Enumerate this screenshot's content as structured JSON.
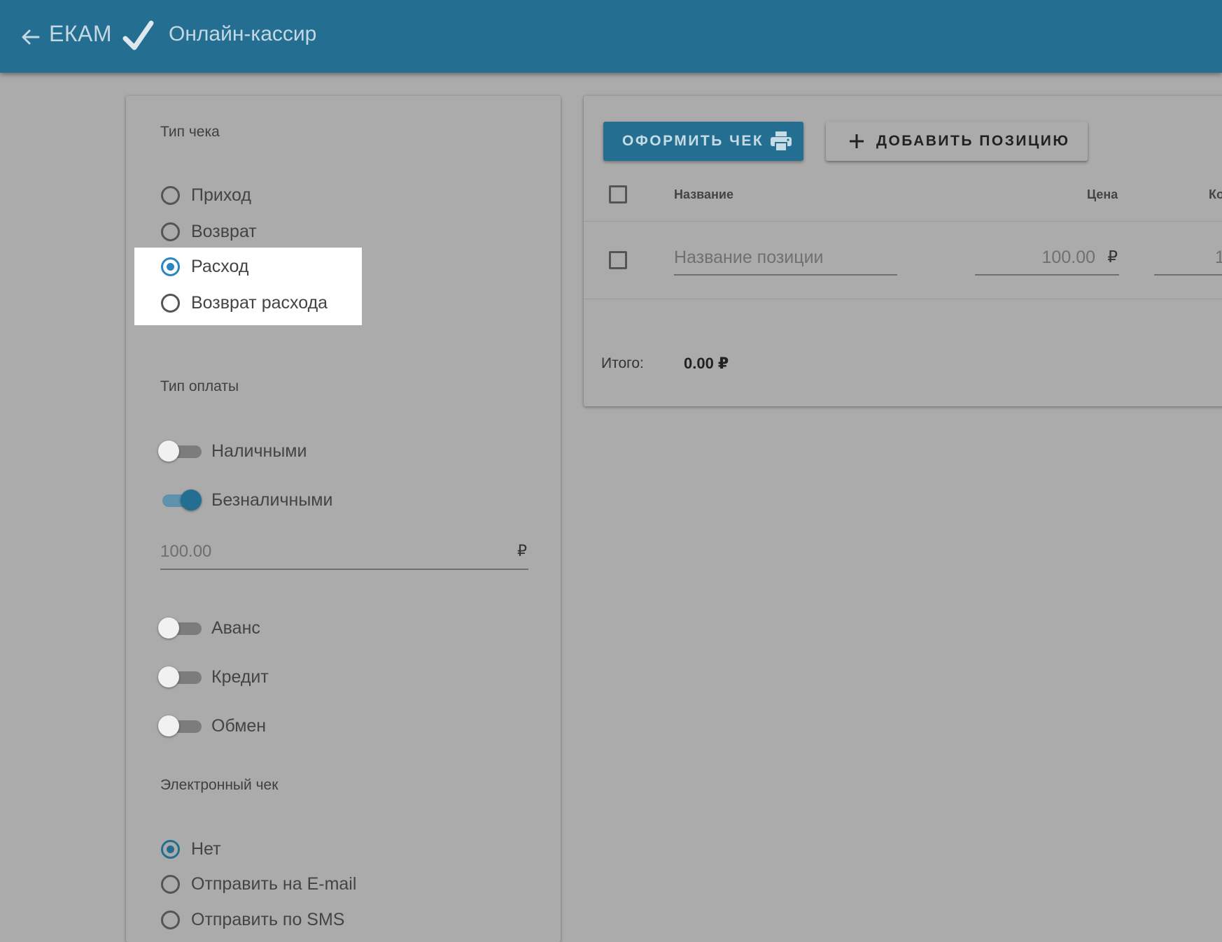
{
  "header": {
    "brand": "ЕКАМ",
    "title": "Онлайн-кассир"
  },
  "receipt_type": {
    "label": "Тип чека",
    "options": [
      {
        "label": "Приход",
        "checked": false
      },
      {
        "label": "Возврат",
        "checked": false
      },
      {
        "label": "Расход",
        "checked": true
      },
      {
        "label": "Возврат расхода",
        "checked": false
      }
    ]
  },
  "payment_type": {
    "label": "Тип оплаты",
    "cash": {
      "label": "Наличными",
      "on": false
    },
    "cashless": {
      "label": "Безналичными",
      "on": true
    },
    "cashless_amount": "100.00",
    "currency": "₽",
    "advance": {
      "label": "Аванс",
      "on": false
    },
    "credit": {
      "label": "Кредит",
      "on": false
    },
    "exchange": {
      "label": "Обмен",
      "on": false
    }
  },
  "electronic_receipt": {
    "label": "Электронный чек",
    "options": [
      {
        "label": "Нет",
        "checked": true
      },
      {
        "label": "Отправить на E-mail",
        "checked": false
      },
      {
        "label": "Отправить по SMS",
        "checked": false
      }
    ]
  },
  "toolbar": {
    "issue_receipt": "ОФОРМИТЬ ЧЕК",
    "add_item": "ДОБАВИТЬ ПОЗИЦИЮ"
  },
  "table": {
    "columns": [
      "Название",
      "Цена",
      "Ко"
    ],
    "rows": [
      {
        "name_placeholder": "Название позиции",
        "price": "100.00",
        "currency": "₽",
        "quantity": "1"
      }
    ]
  },
  "totals": {
    "label": "Итого:",
    "value": "0.00 ₽"
  },
  "colors": {
    "primary": "#246f91",
    "accent": "#2a86c0",
    "overlay_background": "#ababab"
  }
}
